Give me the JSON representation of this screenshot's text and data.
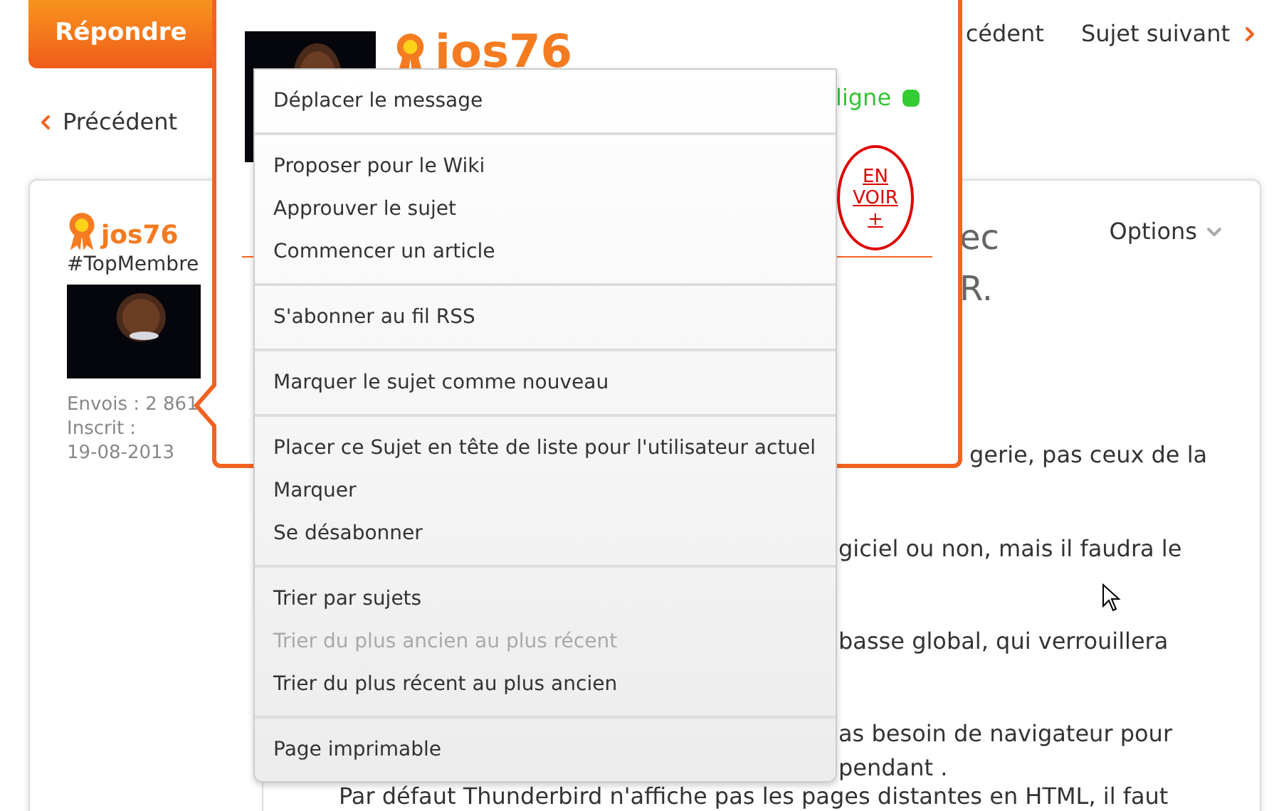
{
  "reply_button": "Répondre",
  "topic_nav": {
    "previous": "cédent",
    "next": "Sujet suivant"
  },
  "back_link": "Précédent",
  "post": {
    "author": {
      "name": "jos76",
      "rank": "#TopMembre",
      "posts": "Envois : 2 861",
      "joined_label": "Inscrit :",
      "joined": "19-08-2013"
    },
    "title_lines": [
      "ec",
      "R."
    ],
    "options": "Options",
    "body_lines": [
      {
        "kind": "beside_popup",
        "text": "gerie, pas ceux de la"
      },
      {
        "kind": "fragment",
        "text": "giciel ou non, mais il faudra le"
      },
      {
        "kind": "fragment",
        "text": "basse global, qui verrouillera"
      },
      {
        "kind": "fragment",
        "text": "as besoin de navigateur pour"
      },
      {
        "kind": "continuation",
        "text": "pendant ."
      },
      {
        "kind": "paragraph",
        "text": "Par défaut Thunderbird n'affiche pas les pages distantes en HTML, il faut"
      }
    ]
  },
  "hover_card": {
    "name": "jos76",
    "status": "ligne",
    "online": true,
    "more_link": [
      "EN",
      "VOIR",
      "+"
    ]
  },
  "menu": {
    "groups": [
      {
        "items": [
          {
            "label": "Déplacer le message",
            "disabled": false
          }
        ]
      },
      {
        "items": [
          {
            "label": "Proposer pour le Wiki",
            "disabled": false
          },
          {
            "label": "Approuver le sujet",
            "disabled": false
          },
          {
            "label": "Commencer un article",
            "disabled": false
          }
        ]
      },
      {
        "items": [
          {
            "label": "S'abonner au fil RSS",
            "disabled": false
          }
        ]
      },
      {
        "items": [
          {
            "label": "Marquer le sujet comme nouveau",
            "disabled": false
          }
        ]
      },
      {
        "items": [
          {
            "label": "Placer ce Sujet en tête de liste pour l'utilisateur actuel",
            "disabled": false
          },
          {
            "label": "Marquer",
            "disabled": false
          },
          {
            "label": "Se désabonner",
            "disabled": false
          }
        ]
      },
      {
        "items": [
          {
            "label": "Trier par sujets",
            "disabled": false
          },
          {
            "label": "Trier du plus ancien au plus récent",
            "disabled": true
          },
          {
            "label": "Trier du plus récent au plus ancien",
            "disabled": false
          }
        ]
      },
      {
        "items": [
          {
            "label": "Page imprimable",
            "disabled": false
          }
        ]
      }
    ]
  }
}
